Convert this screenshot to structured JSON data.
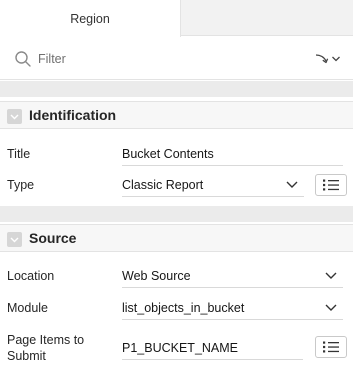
{
  "tabs": {
    "active_label": "Region"
  },
  "filter": {
    "placeholder": "Filter"
  },
  "sections": {
    "identification": {
      "title": "Identification",
      "title_label": "Title",
      "title_value": "Bucket Contents",
      "type_label": "Type",
      "type_value": "Classic Report"
    },
    "source": {
      "title": "Source",
      "location_label": "Location",
      "location_value": "Web Source",
      "module_label": "Module",
      "module_value": "list_objects_in_bucket",
      "page_items_label_line1": "Page Items to",
      "page_items_label_line2": "Submit",
      "page_items_value": "P1_BUCKET_NAME"
    }
  },
  "icons": {
    "search": "search-icon",
    "goto": "goto-arrow-icon",
    "collapse": "chevron-down-icon",
    "list": "list-icon"
  }
}
